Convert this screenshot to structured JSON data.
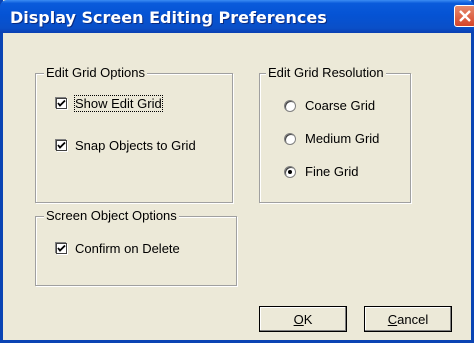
{
  "window": {
    "title": "Display Screen Editing Preferences"
  },
  "edit_grid_options": {
    "legend": "Edit Grid Options",
    "show_edit_grid": {
      "label": "Show Edit Grid",
      "checked": true
    },
    "snap_objects": {
      "label": "Snap Objects to Grid",
      "checked": true
    }
  },
  "edit_grid_resolution": {
    "legend": "Edit Grid Resolution",
    "options": [
      {
        "label": "Coarse Grid",
        "selected": false
      },
      {
        "label": "Medium Grid",
        "selected": false
      },
      {
        "label": "Fine Grid",
        "selected": true
      }
    ]
  },
  "screen_object_options": {
    "legend": "Screen Object Options",
    "confirm_on_delete": {
      "label": "Confirm on Delete",
      "checked": true
    }
  },
  "buttons": {
    "ok": {
      "mnemonic": "O",
      "rest": "K"
    },
    "cancel": {
      "mnemonic": "C",
      "rest": "ancel"
    }
  },
  "icons": {
    "close": "close-icon",
    "check": "check-icon"
  }
}
